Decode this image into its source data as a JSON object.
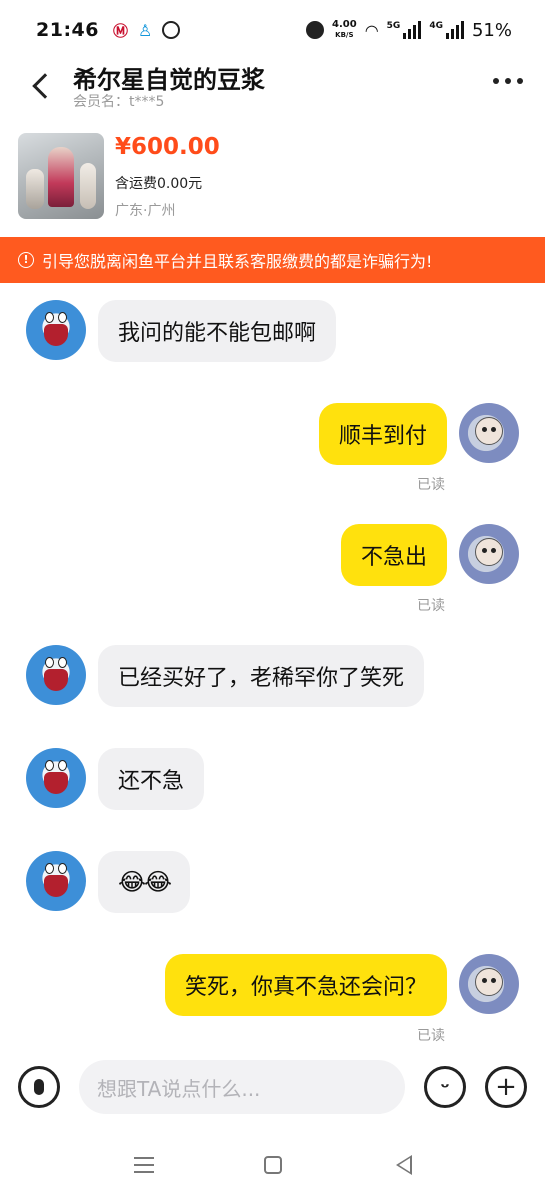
{
  "status_bar": {
    "time": "21:46",
    "network_speed_value": "4.00",
    "network_speed_unit": "KB/S",
    "signal_1": "5G",
    "signal_2": "4G",
    "battery": "51%"
  },
  "header": {
    "title": "希尔星自觉的豆浆",
    "subtitle": "会员名：t***5"
  },
  "product": {
    "price": "¥600.00",
    "shipping": "含运费0.00元",
    "location": "广东·广州"
  },
  "warning": {
    "icon": "!",
    "text": "引导您脱离闲鱼平台并且联系客服缴费的都是诈骗行为!"
  },
  "messages": [
    {
      "side": "in",
      "text": "我问的能不能包邮啊"
    },
    {
      "side": "out",
      "text": "顺丰到付",
      "status": "已读"
    },
    {
      "side": "out",
      "text": "不急出",
      "status": "已读"
    },
    {
      "side": "in",
      "text": "已经买好了，老稀罕你了笑死"
    },
    {
      "side": "in",
      "text": "还不急"
    },
    {
      "side": "in",
      "text": "😂😂"
    },
    {
      "side": "out",
      "text": "笑死，你真不急还会问？",
      "status": "已读"
    }
  ],
  "input": {
    "placeholder": "想跟TA说点什么...",
    "plus": "+"
  },
  "colors": {
    "accent_orange": "#ff5a1f",
    "price_red": "#ff4c1a",
    "bubble_yellow": "#ffe10d",
    "bubble_gray": "#f0f0f2"
  }
}
